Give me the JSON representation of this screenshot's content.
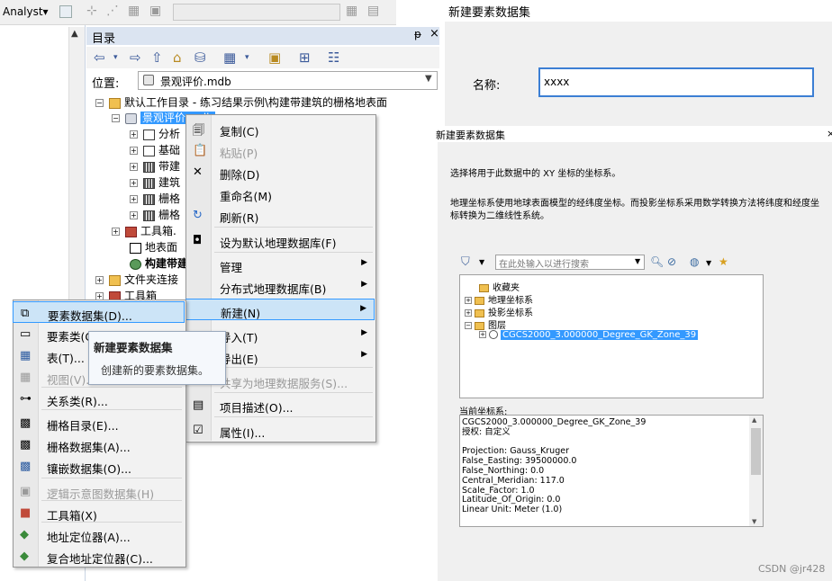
{
  "toolbar": {
    "analyst_label": "Analyst▾"
  },
  "catalog": {
    "title": "目录",
    "pin": "ᵽ",
    "close": "×",
    "location_label": "位置:",
    "location_value": "景观评价.mdb",
    "tree": [
      {
        "label": "默认工作目录 - 练习结果示例\\构建带建筑的栅格地表面"
      },
      {
        "label": "景观评价.mdb"
      },
      {
        "label": "分析"
      },
      {
        "label": "基础"
      },
      {
        "label": "带建"
      },
      {
        "label": "建筑"
      },
      {
        "label": "栅格"
      },
      {
        "label": "栅格"
      },
      {
        "label": "工具箱."
      },
      {
        "label": "地表面"
      },
      {
        "label": "构建带建"
      },
      {
        "label": "文件夹连接"
      },
      {
        "label": "工具箱"
      }
    ]
  },
  "context_menu": {
    "items": [
      {
        "label": "复制(C)",
        "icon": "copy-icon",
        "glyph": "🗐"
      },
      {
        "label": "粘贴(P)",
        "icon": "paste-icon",
        "glyph": "📋"
      },
      {
        "label": "删除(D)",
        "icon": "delete-icon",
        "glyph": "✕"
      },
      {
        "label": "重命名(M)"
      },
      {
        "label": "刷新(R)",
        "icon": "refresh-icon",
        "glyph": "↻"
      },
      {
        "label": "设为默认地理数据库(F)",
        "icon": "default-gdb-icon",
        "glyph": "◘"
      },
      {
        "label": "管理"
      },
      {
        "label": "分布式地理数据库(B)"
      },
      {
        "label": "新建(N)"
      },
      {
        "label": "导入(T)"
      },
      {
        "label": "导出(E)"
      },
      {
        "label": "共享为地理数据服务(S)..."
      },
      {
        "label": "项目描述(O)...",
        "icon": "item-description-icon",
        "glyph": "▤"
      },
      {
        "label": "属性(I)...",
        "icon": "properties-icon",
        "glyph": "☑"
      }
    ]
  },
  "submenu": {
    "items": [
      {
        "label": "要素数据集(D)...",
        "icon": "feature-dataset-icon",
        "glyph": "⧉"
      },
      {
        "label": "要素类(C)",
        "icon": "feature-class-icon",
        "glyph": "▭"
      },
      {
        "label": "表(T)...",
        "icon": "table-icon",
        "glyph": "▦"
      },
      {
        "label": "视图(V)...",
        "icon": "view-icon",
        "glyph": "▦"
      },
      {
        "label": "关系类(R)...",
        "icon": "relationship-class-icon",
        "glyph": "⊶"
      },
      {
        "label": "栅格目录(E)...",
        "icon": "raster-catalog-icon",
        "glyph": "▩"
      },
      {
        "label": "栅格数据集(A)...",
        "icon": "raster-dataset-icon",
        "glyph": "▩"
      },
      {
        "label": "镶嵌数据集(O)...",
        "icon": "mosaic-dataset-icon",
        "glyph": "▩"
      },
      {
        "label": "逻辑示意图数据集(H)",
        "icon": "schematic-dataset-icon",
        "glyph": "▣"
      },
      {
        "label": "工具箱(X)",
        "icon": "toolbox-icon",
        "glyph": "■"
      },
      {
        "label": "地址定位器(A)...",
        "icon": "address-locator-icon",
        "glyph": "◆"
      },
      {
        "label": "复合地址定位器(C)...",
        "icon": "composite-locator-icon",
        "glyph": "◆"
      }
    ]
  },
  "tooltip": {
    "title": "新建要素数据集",
    "body": "创建新的要素数据集。"
  },
  "dialog_name": {
    "title": "新建要素数据集",
    "name_label": "名称:",
    "name_value": "xxxx"
  },
  "dialog_crs": {
    "title": "新建要素数据集",
    "close": "×",
    "desc1": "选择将用于此数据中的 XY 坐标的坐标系。",
    "desc2": "地理坐标系使用地球表面模型的经纬度坐标。而投影坐标系采用数学转换方法将纬度和经度坐标转换为二维线性系统。",
    "search_placeholder": "在此处输入以进行搜索",
    "tree": [
      {
        "label": "收藏夹"
      },
      {
        "label": "地理坐标系"
      },
      {
        "label": "投影坐标系"
      },
      {
        "label": "图层"
      },
      {
        "label": "CGCS2000_3.000000_Degree_GK_Zone_39"
      }
    ],
    "current_label": "当前坐标系:",
    "current_text": "CGCS2000_3.000000_Degree_GK_Zone_39\n授权: 自定义\n\nProjection: Gauss_Kruger\nFalse_Easting: 39500000.0\nFalse_Northing: 0.0\nCentral_Meridian: 117.0\nScale_Factor: 1.0\nLatitude_Of_Origin: 0.0\nLinear Unit: Meter (1.0)"
  },
  "watermark": "CSDN @jr428",
  "colors": {
    "selection": "#3399ff",
    "menu_highlight": "#cce4f7",
    "title_bar": "#dbe4f1"
  }
}
